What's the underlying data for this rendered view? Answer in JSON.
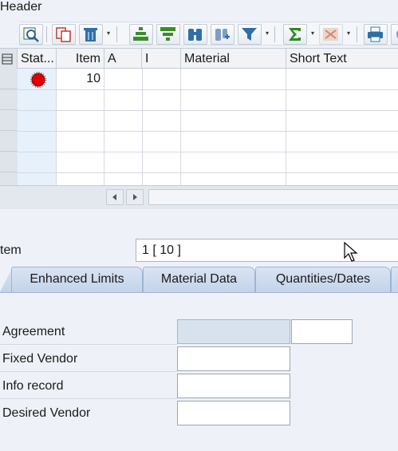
{
  "header": {
    "label": "Header"
  },
  "toolbar": {
    "buttons": [
      "details-icon",
      "copy-icon",
      "delete-icon",
      "sort-ascending-icon",
      "sort-descending-icon",
      "find-icon",
      "find-next-icon",
      "filter-icon",
      "sum-icon",
      "subtotal-icon",
      "print-icon",
      "export-icon"
    ]
  },
  "grid": {
    "columns": [
      "Stat...",
      "Item",
      "A",
      "I",
      "Material",
      "Short Text"
    ],
    "rows": [
      {
        "status": "red-status-icon",
        "item": "10",
        "a": "",
        "i": "",
        "material": "",
        "short_text": ""
      }
    ]
  },
  "item_selector": {
    "label": "tem",
    "value": "1 [ 10 ]"
  },
  "tabs": [
    "Enhanced Limits",
    "Material Data",
    "Quantities/Dates"
  ],
  "form": {
    "agreement_label": "Agreement",
    "agreement_value": "",
    "agreement_item_value": "",
    "fixed_vendor_label": "Fixed Vendor",
    "fixed_vendor_value": "",
    "info_record_label": "Info record",
    "info_record_value": "",
    "desired_vendor_label": "Desired Vendor",
    "desired_vendor_value": ""
  },
  "colors": {
    "status_red": "#e00000",
    "tab_bg": "#cbd9ee",
    "accent": "#1a5fb4"
  }
}
